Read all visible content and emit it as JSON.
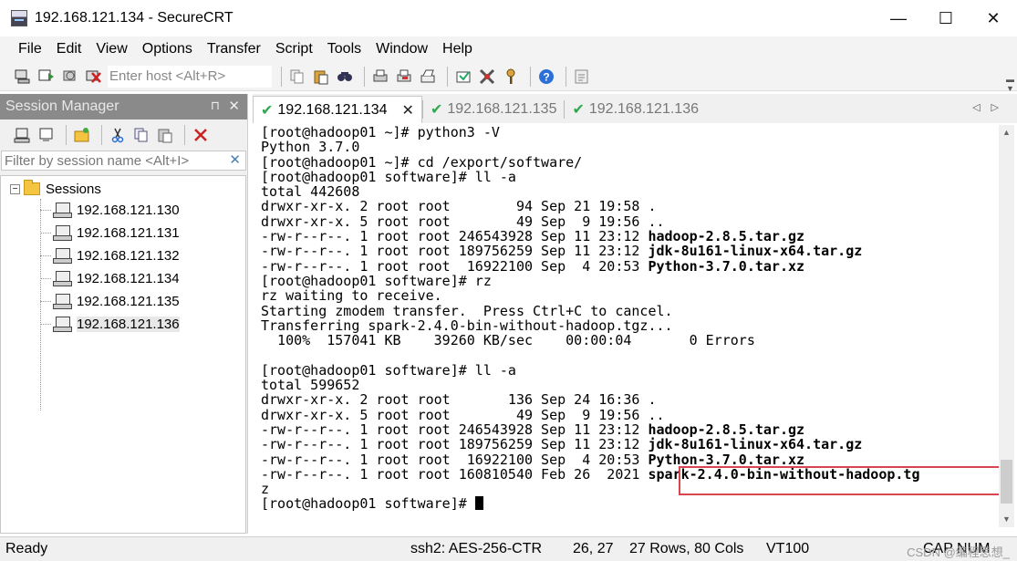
{
  "window": {
    "title": "192.168.121.134 - SecureCRT",
    "minimize": "—",
    "maximize": "☐",
    "close": "✕"
  },
  "menu": [
    "File",
    "Edit",
    "View",
    "Options",
    "Transfer",
    "Script",
    "Tools",
    "Window",
    "Help"
  ],
  "toolbar": {
    "host_placeholder": "Enter host <Alt+R>"
  },
  "session_manager": {
    "title": "Session Manager",
    "pin": "⊓",
    "close": "✕",
    "filter_placeholder": "Filter by session name <Alt+I>",
    "filter_clear": "✕",
    "root": "Sessions",
    "sessions": [
      "192.168.121.130",
      "192.168.121.131",
      "192.168.121.132",
      "192.168.121.134",
      "192.168.121.135",
      "192.168.121.136"
    ]
  },
  "tabs": [
    {
      "label": "192.168.121.134",
      "active": true,
      "close": "✕"
    },
    {
      "label": "192.168.121.135",
      "active": false
    },
    {
      "label": "192.168.121.136",
      "active": false
    }
  ],
  "terminal": {
    "lines": [
      "[root@hadoop01 ~]# python3 -V",
      "Python 3.7.0",
      "[root@hadoop01 ~]# cd /export/software/",
      "[root@hadoop01 software]# ll -a",
      "total 442608",
      "drwxr-xr-x. 2 root root        94 Sep 21 19:58 .",
      "drwxr-xr-x. 5 root root        49 Sep  9 19:56 ..",
      "-rw-r--r--. 1 root root 246543928 Sep 11 23:12 |hadoop-2.8.5.tar.gz",
      "-rw-r--r--. 1 root root 189756259 Sep 11 23:12 |jdk-8u161-linux-x64.tar.gz",
      "-rw-r--r--. 1 root root  16922100 Sep  4 20:53 |Python-3.7.0.tar.xz",
      "[root@hadoop01 software]# rz",
      "rz waiting to receive.",
      "Starting zmodem transfer.  Press Ctrl+C to cancel.",
      "Transferring spark-2.4.0-bin-without-hadoop.tgz...",
      "  100%  157041 KB    39260 KB/sec    00:00:04       0 Errors",
      "",
      "[root@hadoop01 software]# ll -a",
      "total 599652",
      "drwxr-xr-x. 2 root root       136 Sep 24 16:36 .",
      "drwxr-xr-x. 5 root root        49 Sep  9 19:56 ..",
      "-rw-r--r--. 1 root root 246543928 Sep 11 23:12 |hadoop-2.8.5.tar.gz",
      "-rw-r--r--. 1 root root 189756259 Sep 11 23:12 |jdk-8u161-linux-x64.tar.gz",
      "-rw-r--r--. 1 root root  16922100 Sep  4 20:53 |Python-3.7.0.tar.xz",
      "-rw-r--r--. 1 root root 160810540 Feb 26  2021 |spark-2.4.0-bin-without-hadoop.tg",
      "z",
      "[root@hadoop01 software]# "
    ]
  },
  "statusbar": {
    "status": "Ready",
    "cipher": "ssh2: AES-256-CTR",
    "position": "26,  27",
    "size": "27 Rows, 80 Cols",
    "terminal_type": "VT100",
    "keys": "CAP NUM",
    "watermark": "CSDN @编程思想_"
  },
  "colors": {
    "accent_check": "#2fa84f",
    "highlight_border": "#d9454f",
    "session_header_bg": "#8a8a8a"
  }
}
